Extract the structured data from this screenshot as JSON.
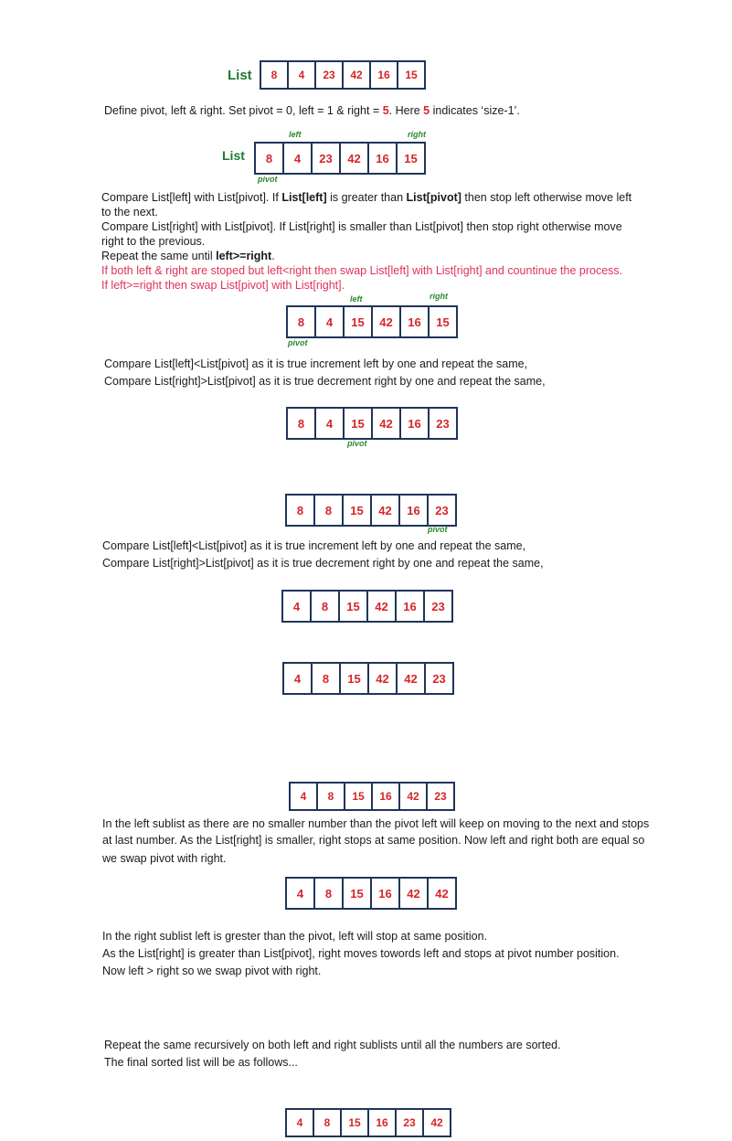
{
  "list_label": "List",
  "tags": {
    "left": "left",
    "right": "right",
    "pivot": "pivot"
  },
  "intro": {
    "a": "Define pivot, left & right. Set pivot = 0, left = 1 & right =",
    "b": "5",
    "c": ". Here",
    "d": "5",
    "e": "indicates ‘size-1’."
  },
  "rules": {
    "r1a": "Compare List[left] with List[pivot]. If",
    "r1b": "List[left]",
    "r1c": "is greater than",
    "r1d": "List[pivot]",
    "r1e": "then stop left otherwise move left",
    "r2": "to the next.",
    "r3": "Compare List[right] with List[pivot]. If List[right] is smaller than List[pivot] then stop right otherwise move",
    "r4": "right to the previous.",
    "r5a": "Repeat the same until",
    "r5b": "left>=right",
    "r5c": ".",
    "r6": "If both left & right are stoped but left<right then swap List[left] with List[right] and countinue the process.",
    "r7": "If left>=right then swap List[pivot] with List[right]."
  },
  "step1": {
    "l1": "Compare List[left]<List[pivot] as it is true increment left by one and repeat the same,",
    "l2": "Compare List[right]>List[pivot] as it is true decrement right by one and repeat the same,"
  },
  "step2": {
    "l1": "Compare List[left]<List[pivot] as it is true increment left by one and repeat the same,",
    "l2": "Compare List[right]>List[pivot] as it is true decrement right by one and repeat the same,"
  },
  "left_sublist": {
    "l1": "In the left sublist as there are no smaller number than the pivot left will keep on moving to the next and stops",
    "l2": "at last number. As the List[right] is smaller, right stops at same position. Now left and right both are equal so",
    "l3": "we swap pivot with right."
  },
  "right_sublist": {
    "l1": "In the right sublist left is grester than the pivot, left will stop at same position.",
    "l2": "As the List[right] is greater than List[pivot], right moves towords left and stops at pivot number  position.",
    "l3": "Now left > right so we swap pivot with right."
  },
  "final": {
    "l1": "Repeat the same recursively on both left and right sublists until all the numbers are sorted.",
    "l2": "The final sorted list will be as follows..."
  },
  "arrays": {
    "a1": [
      "8",
      "4",
      "23",
      "42",
      "16",
      "15"
    ],
    "a2": [
      "8",
      "4",
      "23",
      "42",
      "16",
      "15"
    ],
    "a3": [
      "8",
      "4",
      "15",
      "42",
      "16",
      "15"
    ],
    "a4": [
      "8",
      "4",
      "15",
      "42",
      "16",
      "23"
    ],
    "a5": [
      "8",
      "8",
      "15",
      "42",
      "16",
      "23"
    ],
    "a6": [
      "4",
      "8",
      "15",
      "42",
      "16",
      "23"
    ],
    "a7": [
      "4",
      "8",
      "15",
      "42",
      "42",
      "23"
    ],
    "a8": [
      "4",
      "8",
      "15",
      "16",
      "42",
      "23"
    ],
    "a9": [
      "4",
      "8",
      "15",
      "16",
      "42",
      "42"
    ],
    "a10": [
      "4",
      "8",
      "15",
      "16",
      "23",
      "42"
    ]
  }
}
